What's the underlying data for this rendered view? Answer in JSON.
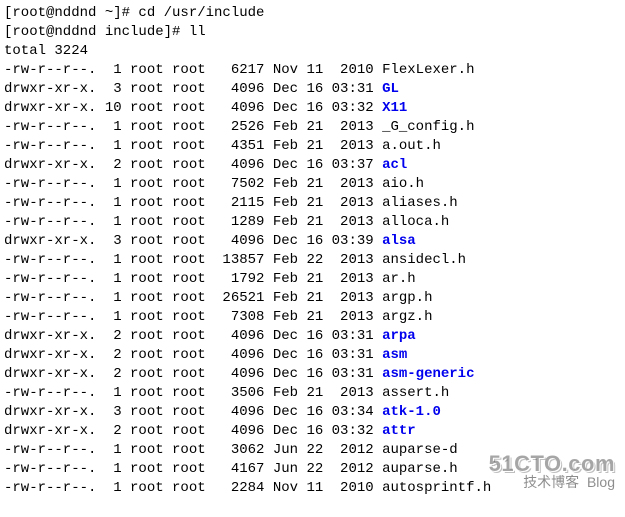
{
  "prompt1": "[root@nddnd ~]# ",
  "cmd1": "cd /usr/include",
  "prompt2": "[root@nddnd include]# ",
  "cmd2": "ll",
  "total": "total 3224",
  "rows": [
    {
      "perm": "-rw-r--r--.",
      "links": "1",
      "user": "root",
      "group": "root",
      "size": "6217",
      "date": "Nov 11  2010",
      "name": "FlexLexer.h",
      "dir": false
    },
    {
      "perm": "drwxr-xr-x.",
      "links": "3",
      "user": "root",
      "group": "root",
      "size": "4096",
      "date": "Dec 16 03:31",
      "name": "GL",
      "dir": true
    },
    {
      "perm": "drwxr-xr-x.",
      "links": "10",
      "user": "root",
      "group": "root",
      "size": "4096",
      "date": "Dec 16 03:32",
      "name": "X11",
      "dir": true
    },
    {
      "perm": "-rw-r--r--.",
      "links": "1",
      "user": "root",
      "group": "root",
      "size": "2526",
      "date": "Feb 21  2013",
      "name": "_G_config.h",
      "dir": false
    },
    {
      "perm": "-rw-r--r--.",
      "links": "1",
      "user": "root",
      "group": "root",
      "size": "4351",
      "date": "Feb 21  2013",
      "name": "a.out.h",
      "dir": false
    },
    {
      "perm": "drwxr-xr-x.",
      "links": "2",
      "user": "root",
      "group": "root",
      "size": "4096",
      "date": "Dec 16 03:37",
      "name": "acl",
      "dir": true
    },
    {
      "perm": "-rw-r--r--.",
      "links": "1",
      "user": "root",
      "group": "root",
      "size": "7502",
      "date": "Feb 21  2013",
      "name": "aio.h",
      "dir": false
    },
    {
      "perm": "-rw-r--r--.",
      "links": "1",
      "user": "root",
      "group": "root",
      "size": "2115",
      "date": "Feb 21  2013",
      "name": "aliases.h",
      "dir": false
    },
    {
      "perm": "-rw-r--r--.",
      "links": "1",
      "user": "root",
      "group": "root",
      "size": "1289",
      "date": "Feb 21  2013",
      "name": "alloca.h",
      "dir": false
    },
    {
      "perm": "drwxr-xr-x.",
      "links": "3",
      "user": "root",
      "group": "root",
      "size": "4096",
      "date": "Dec 16 03:39",
      "name": "alsa",
      "dir": true
    },
    {
      "perm": "-rw-r--r--.",
      "links": "1",
      "user": "root",
      "group": "root",
      "size": "13857",
      "date": "Feb 22  2013",
      "name": "ansidecl.h",
      "dir": false
    },
    {
      "perm": "-rw-r--r--.",
      "links": "1",
      "user": "root",
      "group": "root",
      "size": "1792",
      "date": "Feb 21  2013",
      "name": "ar.h",
      "dir": false
    },
    {
      "perm": "-rw-r--r--.",
      "links": "1",
      "user": "root",
      "group": "root",
      "size": "26521",
      "date": "Feb 21  2013",
      "name": "argp.h",
      "dir": false
    },
    {
      "perm": "-rw-r--r--.",
      "links": "1",
      "user": "root",
      "group": "root",
      "size": "7308",
      "date": "Feb 21  2013",
      "name": "argz.h",
      "dir": false
    },
    {
      "perm": "drwxr-xr-x.",
      "links": "2",
      "user": "root",
      "group": "root",
      "size": "4096",
      "date": "Dec 16 03:31",
      "name": "arpa",
      "dir": true
    },
    {
      "perm": "drwxr-xr-x.",
      "links": "2",
      "user": "root",
      "group": "root",
      "size": "4096",
      "date": "Dec 16 03:31",
      "name": "asm",
      "dir": true
    },
    {
      "perm": "drwxr-xr-x.",
      "links": "2",
      "user": "root",
      "group": "root",
      "size": "4096",
      "date": "Dec 16 03:31",
      "name": "asm-generic",
      "dir": true
    },
    {
      "perm": "-rw-r--r--.",
      "links": "1",
      "user": "root",
      "group": "root",
      "size": "3506",
      "date": "Feb 21  2013",
      "name": "assert.h",
      "dir": false
    },
    {
      "perm": "drwxr-xr-x.",
      "links": "3",
      "user": "root",
      "group": "root",
      "size": "4096",
      "date": "Dec 16 03:34",
      "name": "atk-1.0",
      "dir": true
    },
    {
      "perm": "drwxr-xr-x.",
      "links": "2",
      "user": "root",
      "group": "root",
      "size": "4096",
      "date": "Dec 16 03:32",
      "name": "attr",
      "dir": true
    },
    {
      "perm": "-rw-r--r--.",
      "links": "1",
      "user": "root",
      "group": "root",
      "size": "3062",
      "date": "Jun 22  2012",
      "name": "auparse-d",
      "dir": false
    },
    {
      "perm": "-rw-r--r--.",
      "links": "1",
      "user": "root",
      "group": "root",
      "size": "4167",
      "date": "Jun 22  2012",
      "name": "auparse.h",
      "dir": false
    },
    {
      "perm": "-rw-r--r--.",
      "links": "1",
      "user": "root",
      "group": "root",
      "size": "2284",
      "date": "Nov 11  2010",
      "name": "autosprintf.h",
      "dir": false
    }
  ],
  "watermark": {
    "url": "51CTO.com",
    "sub1": "技术博客",
    "sub2": "Blog"
  }
}
